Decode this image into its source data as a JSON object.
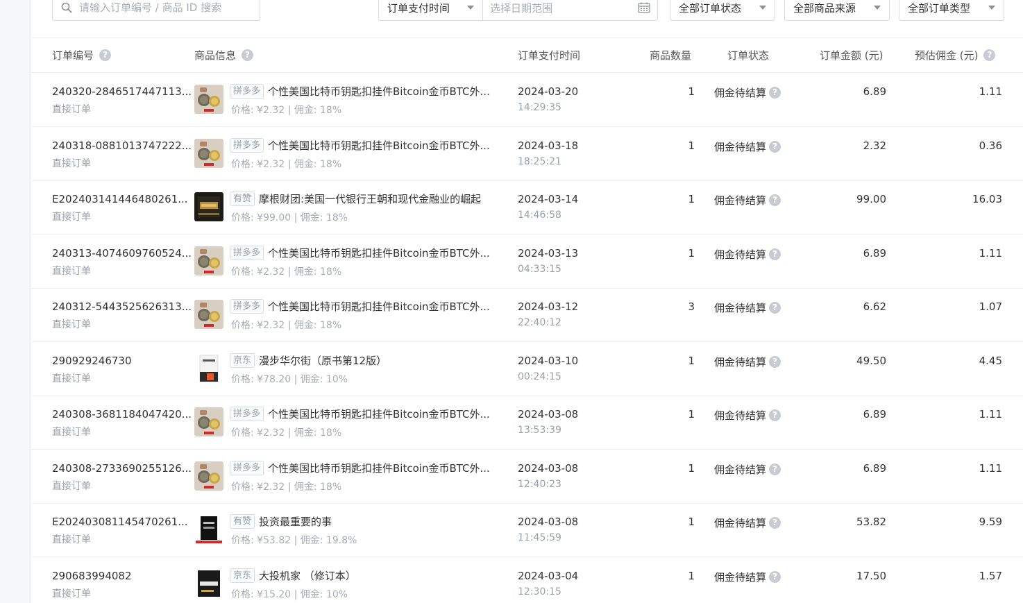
{
  "filters": {
    "search_placeholder": "请输入订单编号 / 商品 ID 搜索",
    "time_type": "订单支付时间",
    "date_placeholder": "选择日期范围",
    "order_status": "全部订单状态",
    "product_source": "全部商品来源",
    "order_type": "全部订单类型"
  },
  "columns": {
    "order_id": "订单编号",
    "product_info": "商品信息",
    "pay_time": "订单支付时间",
    "quantity": "商品数量",
    "status": "订单状态",
    "amount": "订单金额 (元)",
    "commission": "预估佣金 (元)"
  },
  "colors": {
    "pinduoduo_thumb": "#8a7a62",
    "accent": "#e02e24"
  },
  "rows": [
    {
      "order_id": "240320-2846517447113...",
      "order_type": "直接订单",
      "source": "拼多多",
      "title": "个性美国比特币钥匙扣挂件Bitcoin金币BTC外...",
      "meta": "价格: ¥2.32 | 佣金: 18%",
      "date": "2024-03-20",
      "time": "14:29:35",
      "qty": "1",
      "status": "佣金待结算",
      "amount": "6.89",
      "commission": "1.11",
      "thumb": "coin-thumb"
    },
    {
      "order_id": "240318-0881013747222...",
      "order_type": "直接订单",
      "source": "拼多多",
      "title": "个性美国比特币钥匙扣挂件Bitcoin金币BTC外...",
      "meta": "价格: ¥2.32 | 佣金: 18%",
      "date": "2024-03-18",
      "time": "18:25:21",
      "qty": "1",
      "status": "佣金待结算",
      "amount": "2.32",
      "commission": "0.36",
      "thumb": "coin-thumb"
    },
    {
      "order_id": "E202403141446480261...",
      "order_type": "直接订单",
      "source": "有赞",
      "title": "摩根财团:美国一代银行王朝和现代金融业的崛起",
      "meta": "价格: ¥99.00 | 佣金: 18%",
      "date": "2024-03-14",
      "time": "14:46:58",
      "qty": "1",
      "status": "佣金待结算",
      "amount": "99.00",
      "commission": "16.03",
      "thumb": "book-gold-thumb"
    },
    {
      "order_id": "240313-4074609760524...",
      "order_type": "直接订单",
      "source": "拼多多",
      "title": "个性美国比特币钥匙扣挂件Bitcoin金币BTC外...",
      "meta": "价格: ¥2.32 | 佣金: 18%",
      "date": "2024-03-13",
      "time": "04:33:15",
      "qty": "1",
      "status": "佣金待结算",
      "amount": "6.89",
      "commission": "1.11",
      "thumb": "coin-thumb"
    },
    {
      "order_id": "240312-5443525626313...",
      "order_type": "直接订单",
      "source": "拼多多",
      "title": "个性美国比特币钥匙扣挂件Bitcoin金币BTC外...",
      "meta": "价格: ¥2.32 | 佣金: 18%",
      "date": "2024-03-12",
      "time": "22:40:12",
      "qty": "3",
      "status": "佣金待结算",
      "amount": "6.62",
      "commission": "1.07",
      "thumb": "coin-thumb"
    },
    {
      "order_id": "290929246730",
      "order_type": "直接订单",
      "source": "京东",
      "title": "漫步华尔街（原书第12版）",
      "meta": "价格: ¥78.20 | 佣金: 10%",
      "date": "2024-03-10",
      "time": "00:24:15",
      "qty": "1",
      "status": "佣金待结算",
      "amount": "49.50",
      "commission": "4.45",
      "thumb": "book-white-thumb"
    },
    {
      "order_id": "240308-3681184047420...",
      "order_type": "直接订单",
      "source": "拼多多",
      "title": "个性美国比特币钥匙扣挂件Bitcoin金币BTC外...",
      "meta": "价格: ¥2.32 | 佣金: 18%",
      "date": "2024-03-08",
      "time": "13:53:39",
      "qty": "1",
      "status": "佣金待结算",
      "amount": "6.89",
      "commission": "1.11",
      "thumb": "coin-thumb"
    },
    {
      "order_id": "240308-2733690255126...",
      "order_type": "直接订单",
      "source": "拼多多",
      "title": "个性美国比特币钥匙扣挂件Bitcoin金币BTC外...",
      "meta": "价格: ¥2.32 | 佣金: 18%",
      "date": "2024-03-08",
      "time": "12:40:23",
      "qty": "1",
      "status": "佣金待结算",
      "amount": "6.89",
      "commission": "1.11",
      "thumb": "coin-thumb"
    },
    {
      "order_id": "E202403081145470261...",
      "order_type": "直接订单",
      "source": "有赞",
      "title": "投资最重要的事",
      "meta": "价格: ¥53.82 | 佣金: 19.8%",
      "date": "2024-03-08",
      "time": "11:45:59",
      "qty": "1",
      "status": "佣金待结算",
      "amount": "53.82",
      "commission": "9.59",
      "thumb": "book-black-thumb"
    },
    {
      "order_id": "290683994082",
      "order_type": "直接订单",
      "source": "京东",
      "title": "大投机家 （修订本）",
      "meta": "价格: ¥15.20 | 佣金: 10%",
      "date": "2024-03-04",
      "time": "12:30:15",
      "qty": "1",
      "status": "佣金待结算",
      "amount": "17.50",
      "commission": "1.57",
      "thumb": "book-dark-thumb"
    }
  ]
}
